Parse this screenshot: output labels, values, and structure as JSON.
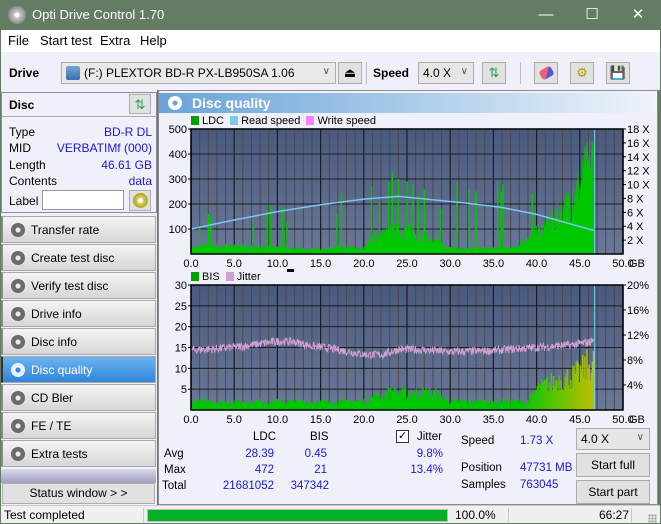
{
  "window": {
    "title": "Opti Drive Control 1.70",
    "minimize_glyph": "—",
    "maximize_glyph": "☐",
    "close_glyph": "✕"
  },
  "menu": [
    "File",
    "Start test",
    "Extra",
    "Help"
  ],
  "toolbar": {
    "drive_label": "Drive",
    "drive_value": "(F:)  PLEXTOR BD-R  PX-LB950SA 1.06",
    "speed_label": "Speed",
    "speed_value": "4.0 X",
    "icons": [
      "drive-icon",
      "eject-icon",
      "refresh-icon",
      "eraser-icon",
      "settings-icon",
      "save-icon"
    ]
  },
  "disc": {
    "header": "Disc",
    "fields": [
      {
        "label": "Type",
        "value": "BD-R DL"
      },
      {
        "label": "MID",
        "value": "VERBATIMf (000)"
      },
      {
        "label": "Length",
        "value": "46.61 GB"
      },
      {
        "label": "Contents",
        "value": "data"
      }
    ],
    "label_field": {
      "label": "Label",
      "value": ""
    }
  },
  "nav": [
    {
      "label": "Transfer rate",
      "active": false
    },
    {
      "label": "Create test disc",
      "active": false
    },
    {
      "label": "Verify test disc",
      "active": false
    },
    {
      "label": "Drive info",
      "active": false
    },
    {
      "label": "Disc info",
      "active": false
    },
    {
      "label": "Disc quality",
      "active": true
    },
    {
      "label": "CD Bler",
      "active": false
    },
    {
      "label": "FE / TE",
      "active": false
    },
    {
      "label": "Extra tests",
      "active": false
    }
  ],
  "status_window_label": "Status window > >",
  "panel_title": "Disc quality",
  "colors": {
    "ldc": "#00c800",
    "read_speed": "#78c8f0",
    "write_speed": "#ff80ff",
    "bis": "#00c800",
    "jitter": "#d0a0d0",
    "plot_bg_top": "#4a5a7e",
    "plot_bg_bottom": "#6a7898",
    "accent": "#2f86d8",
    "progress": "#06b025"
  },
  "chart_data": [
    {
      "type": "bar",
      "title": "LDC / Read speed",
      "legend": [
        "LDC",
        "Read speed",
        "Write speed"
      ],
      "legend_position": "top-left",
      "xlabel": "GB",
      "x_ticks": [
        "0.0",
        "5.0",
        "10.0",
        "15.0",
        "20.0",
        "25.0",
        "30.0",
        "35.0",
        "40.0",
        "45.0",
        "50.0"
      ],
      "xlim": [
        0,
        50
      ],
      "ylim": [
        0,
        500
      ],
      "y_ticks": [
        "100",
        "200",
        "300",
        "400",
        "500"
      ],
      "y2lim": [
        0,
        18
      ],
      "y2_ticks": [
        "2 X",
        "4 X",
        "6 X",
        "8 X",
        "10 X",
        "12 X",
        "14 X",
        "16 X",
        "18 X"
      ],
      "grid": true,
      "ldc_profile": {
        "x": [
          0,
          2,
          4,
          6,
          8,
          10,
          12,
          14,
          16,
          18,
          20,
          21,
          22,
          23,
          24,
          25,
          26,
          28,
          30,
          32,
          34,
          36,
          38,
          40,
          41,
          42,
          43,
          44,
          45,
          46,
          46.6
        ],
        "base": [
          25,
          30,
          30,
          28,
          25,
          25,
          20,
          18,
          20,
          25,
          20,
          60,
          70,
          80,
          90,
          90,
          80,
          50,
          20,
          20,
          20,
          20,
          30,
          80,
          100,
          130,
          160,
          200,
          260,
          330,
          380
        ],
        "spikes": [
          {
            "x": 1.0,
            "v": 110
          },
          {
            "x": 2.0,
            "v": 160
          },
          {
            "x": 2.3,
            "v": 150
          },
          {
            "x": 7.2,
            "v": 130
          },
          {
            "x": 9.2,
            "v": 195
          },
          {
            "x": 8.8,
            "v": 160
          },
          {
            "x": 10.6,
            "v": 190
          },
          {
            "x": 11.1,
            "v": 130
          },
          {
            "x": 17.4,
            "v": 245
          },
          {
            "x": 16.9,
            "v": 160
          },
          {
            "x": 20.9,
            "v": 270
          },
          {
            "x": 21.8,
            "v": 205
          },
          {
            "x": 22.9,
            "v": 290
          },
          {
            "x": 23.3,
            "v": 325
          },
          {
            "x": 24.0,
            "v": 300
          },
          {
            "x": 25.0,
            "v": 290
          },
          {
            "x": 25.7,
            "v": 280
          },
          {
            "x": 26.3,
            "v": 230
          },
          {
            "x": 27.0,
            "v": 260
          },
          {
            "x": 28.9,
            "v": 180
          },
          {
            "x": 30.8,
            "v": 290
          },
          {
            "x": 32.2,
            "v": 260
          },
          {
            "x": 33.0,
            "v": 250
          },
          {
            "x": 35.5,
            "v": 290
          },
          {
            "x": 35.9,
            "v": 250
          },
          {
            "x": 36.1,
            "v": 280
          },
          {
            "x": 39.5,
            "v": 240
          }
        ],
        "max": 472
      },
      "read_speed": {
        "x": [
          0,
          5,
          10,
          15,
          20,
          24,
          28,
          32,
          36,
          40,
          44,
          46.6
        ],
        "values": [
          3.6,
          4.9,
          6.1,
          7.1,
          7.9,
          8.3,
          7.8,
          7.3,
          6.7,
          5.7,
          4.3,
          3.4
        ]
      }
    },
    {
      "type": "bar",
      "title": "BIS / Jitter",
      "legend": [
        "BIS",
        "Jitter"
      ],
      "legend_position": "top-left",
      "xlabel": "GB",
      "x_ticks": [
        "0.0",
        "5.0",
        "10.0",
        "15.0",
        "20.0",
        "25.0",
        "30.0",
        "35.0",
        "40.0",
        "45.0",
        "50.0"
      ],
      "xlim": [
        0,
        50
      ],
      "ylim": [
        0,
        30
      ],
      "y_ticks": [
        "5",
        "10",
        "15",
        "20",
        "25",
        "30"
      ],
      "y2lim": [
        0,
        20
      ],
      "y2_ticks": [
        "4%",
        "8%",
        "12%",
        "16%",
        "20%"
      ],
      "grid": true,
      "bis_profile": {
        "x": [
          0,
          5,
          10,
          15,
          20,
          21,
          23,
          25,
          28,
          30,
          35,
          39,
          40,
          42,
          44,
          45,
          46,
          46.6
        ],
        "base": [
          2,
          2,
          2,
          2,
          2,
          3,
          4,
          4,
          4,
          2,
          2,
          2,
          5,
          7,
          8,
          9,
          11,
          12
        ],
        "max": 21
      },
      "jitter": {
        "x": [
          0,
          3,
          6,
          8,
          10,
          12,
          14,
          16,
          18,
          20,
          22,
          24,
          27,
          30,
          35,
          40,
          44,
          46,
          46.6
        ],
        "values": [
          9.6,
          9.8,
          10.2,
          10.6,
          11.0,
          10.9,
          10.2,
          9.9,
          9.4,
          8.9,
          8.8,
          9.7,
          9.6,
          9.3,
          9.5,
          10.0,
          10.4,
          10.8,
          11.2
        ]
      }
    }
  ],
  "stats": {
    "col_ldc": "LDC",
    "col_bis": "BIS",
    "jitter_label": "Jitter",
    "jitter_checked": true,
    "rows": [
      {
        "label": "Avg",
        "ldc": "28.39",
        "bis": "0.45",
        "jitter": "9.8%"
      },
      {
        "label": "Max",
        "ldc": "472",
        "bis": "21",
        "jitter": "13.4%"
      },
      {
        "label": "Total",
        "ldc": "21681052",
        "bis": "347342",
        "jitter": ""
      }
    ],
    "speed_label": "Speed",
    "speed_value": "1.73 X",
    "position_label": "Position",
    "position_value": "47731 MB",
    "samples_label": "Samples",
    "samples_value": "763045",
    "speed_select": "4.0 X",
    "start_full": "Start full",
    "start_part": "Start part"
  },
  "statusbar": {
    "text": "Test completed",
    "progress": 1.0,
    "progress_text": "100.0%",
    "time": "66:27"
  }
}
